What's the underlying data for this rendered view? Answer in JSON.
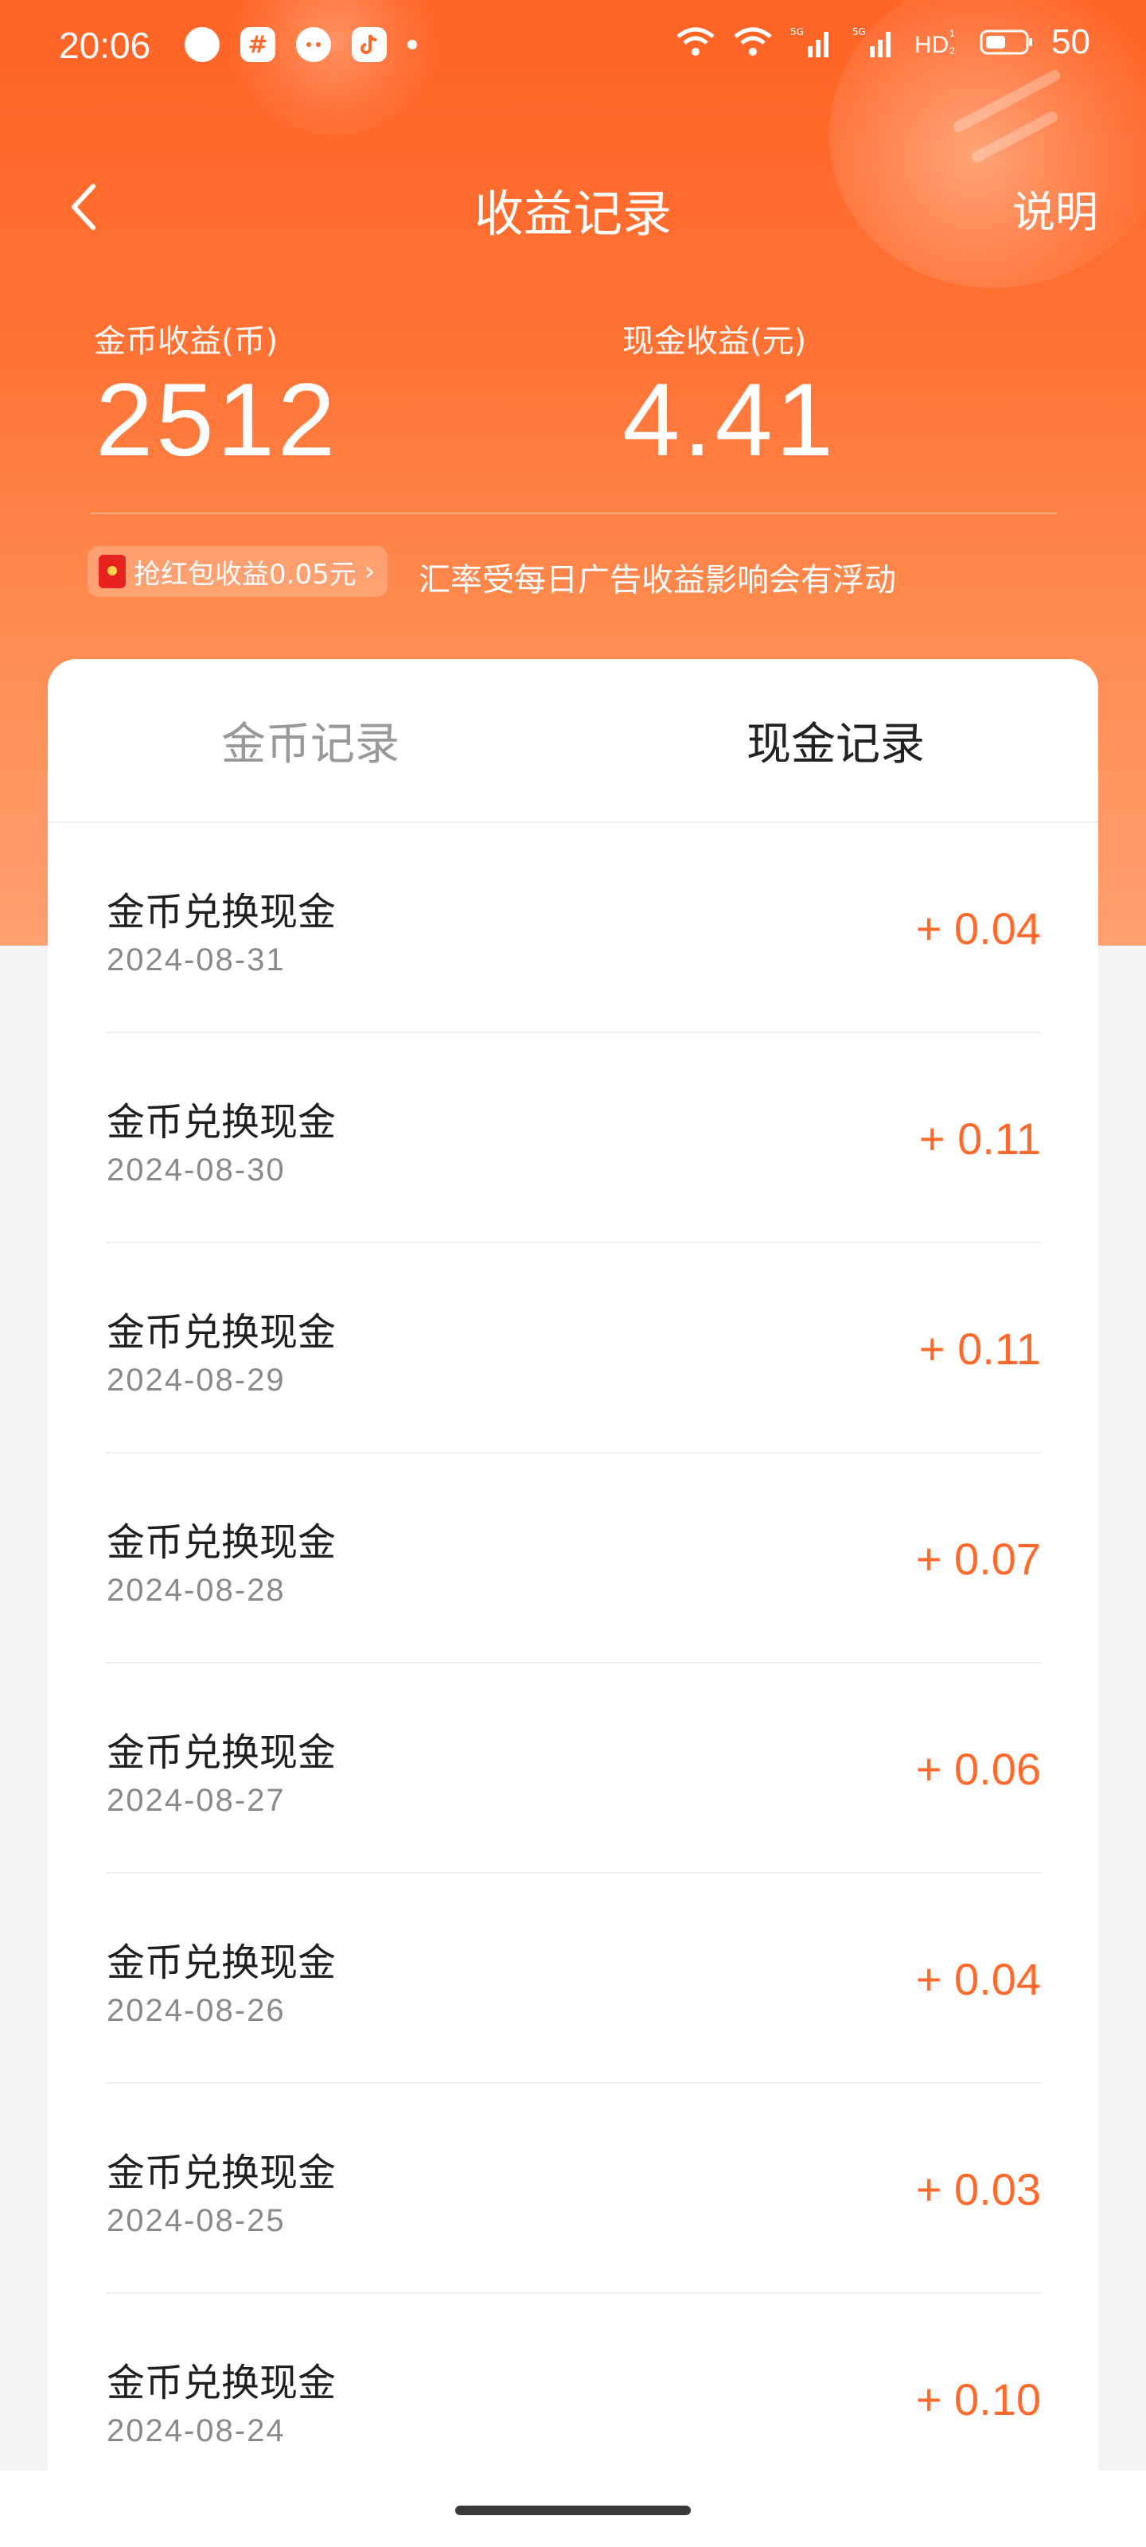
{
  "status_bar": {
    "time": "20:06",
    "app_icons": [
      "chat-bubble-icon",
      "hashtag-app-icon",
      "wechat-icon",
      "tiktok-icon"
    ],
    "right_icons": [
      "wifi-icon",
      "wifi-icon",
      "signal-5g-icon",
      "signal-5g-icon",
      "hd-icon",
      "battery-icon"
    ],
    "signal_label": "5G",
    "hd_label": "HD",
    "battery": "50"
  },
  "nav": {
    "title": "收益记录",
    "help_label": "说明"
  },
  "summary": {
    "coin_label": "金币收益(币)",
    "coin_value": "2512",
    "cash_label": "现金收益(元)",
    "cash_value": "4.41",
    "promo_label": "抢红包收益0.05元",
    "note": "汇率受每日广告收益影响会有浮动"
  },
  "tabs": [
    {
      "label": "金币记录",
      "active": false
    },
    {
      "label": "现金记录",
      "active": true
    }
  ],
  "records": [
    {
      "title": "金币兑换现金",
      "date": "2024-08-31",
      "amount": "+ 0.04"
    },
    {
      "title": "金币兑换现金",
      "date": "2024-08-30",
      "amount": "+ 0.11"
    },
    {
      "title": "金币兑换现金",
      "date": "2024-08-29",
      "amount": "+ 0.11"
    },
    {
      "title": "金币兑换现金",
      "date": "2024-08-28",
      "amount": "+ 0.07"
    },
    {
      "title": "金币兑换现金",
      "date": "2024-08-27",
      "amount": "+ 0.06"
    },
    {
      "title": "金币兑换现金",
      "date": "2024-08-26",
      "amount": "+ 0.04"
    },
    {
      "title": "金币兑换现金",
      "date": "2024-08-25",
      "amount": "+ 0.03"
    },
    {
      "title": "金币兑换现金",
      "date": "2024-08-24",
      "amount": "+ 0.10"
    }
  ],
  "colors": {
    "brand_orange": "#ff6425",
    "amount_orange": "#ff6a2c",
    "tab_inactive": "#999999",
    "tab_active": "#222222"
  }
}
